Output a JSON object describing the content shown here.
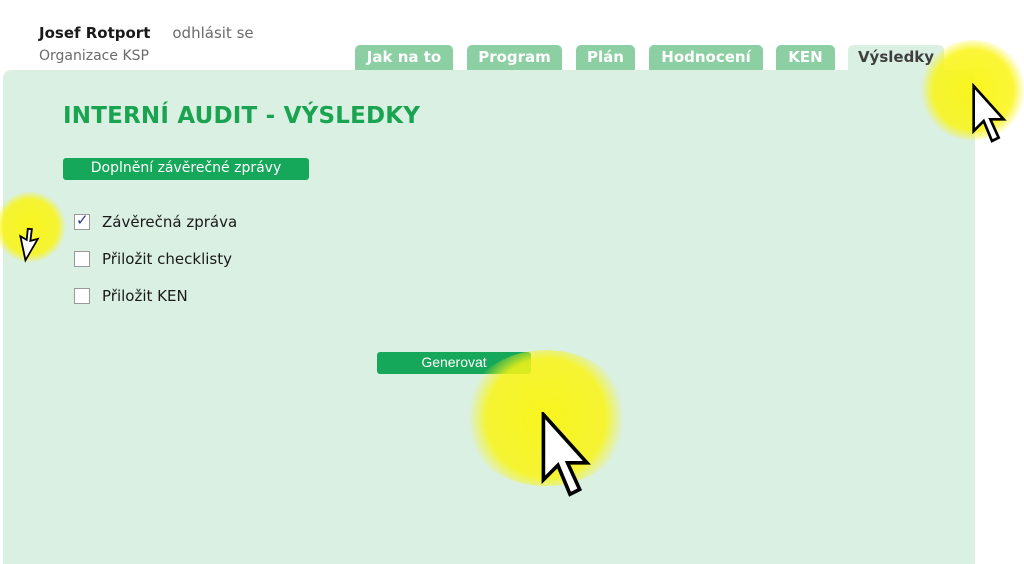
{
  "header": {
    "user_name": "Josef Rotport",
    "logout_label": "odhlásit se",
    "organization": "Organizace KSP"
  },
  "tabs": [
    {
      "label": "Jak na to",
      "active": false
    },
    {
      "label": "Program",
      "active": false
    },
    {
      "label": "Plán",
      "active": false
    },
    {
      "label": "Hodnocení",
      "active": false
    },
    {
      "label": "KEN",
      "active": false
    },
    {
      "label": "Výsledky",
      "active": true
    }
  ],
  "main": {
    "title": "INTERNÍ AUDIT - VÝSLEDKY",
    "section_button": "Doplnění závěrečné zprávy",
    "options": [
      {
        "label": "Závěrečná zpráva",
        "checked": true
      },
      {
        "label": "Přiložit checklisty",
        "checked": false
      },
      {
        "label": "Přiložit KEN",
        "checked": false
      }
    ],
    "generate_button": "Generovat"
  },
  "icons": {
    "pointer": "mouse-pointer-icon",
    "check": "checkmark-icon"
  },
  "colors": {
    "accent_green": "#16a85a",
    "title_green": "#1aa350",
    "tab_inactive": "#8ccfa3",
    "panel_bg": "#daf0e2",
    "cursor_highlight": "#f5f21a"
  }
}
